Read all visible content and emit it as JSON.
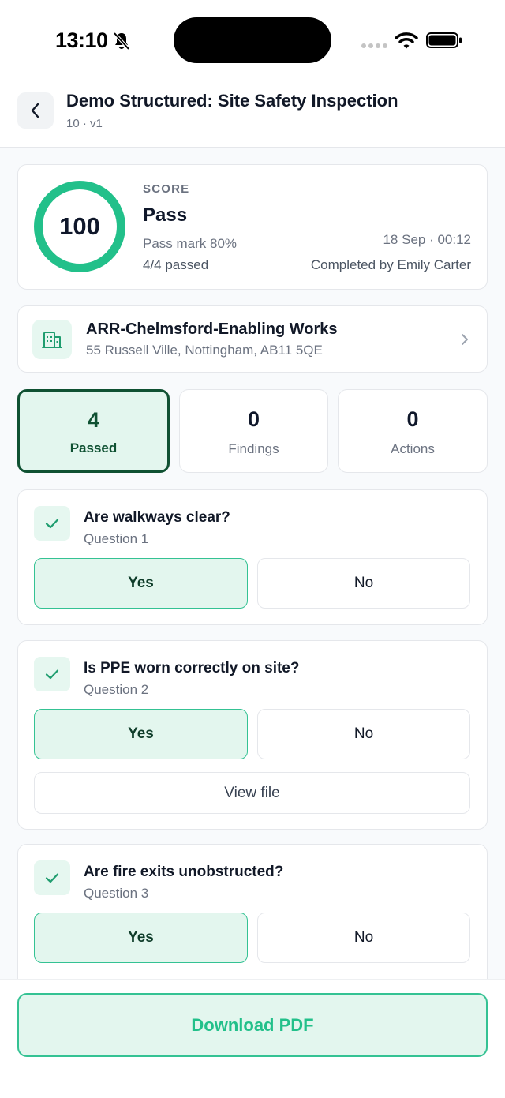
{
  "status": {
    "time": "13:10"
  },
  "header": {
    "title": "Demo Structured: Site Safety Inspection",
    "subtitle": "10 · v1"
  },
  "score": {
    "label": "SCORE",
    "value": "100",
    "result": "Pass",
    "pass_mark": "Pass mark 80%",
    "passed": "4/4 passed",
    "date": "18 Sep · 00:12",
    "completed_by": "Completed by Emily Carter"
  },
  "site": {
    "name": "ARR-Chelmsford-Enabling Works",
    "address": "55 Russell Ville, Nottingham, AB11 5QE"
  },
  "stats": [
    {
      "value": "4",
      "label": "Passed"
    },
    {
      "value": "0",
      "label": "Findings"
    },
    {
      "value": "0",
      "label": "Actions"
    }
  ],
  "questions": [
    {
      "title": "Are walkways clear?",
      "subtitle": "Question 1",
      "yes": "Yes",
      "no": "No"
    },
    {
      "title": "Is PPE worn correctly on site?",
      "subtitle": "Question 2",
      "yes": "Yes",
      "no": "No",
      "file": "View file"
    },
    {
      "title": "Are fire exits unobstructed?",
      "subtitle": "Question 3",
      "yes": "Yes",
      "no": "No"
    }
  ],
  "footer": {
    "download": "Download PDF"
  },
  "colors": {
    "accent": "#22c08a",
    "accent_dark": "#0f5132",
    "accent_bg": "#e3f6ee"
  }
}
